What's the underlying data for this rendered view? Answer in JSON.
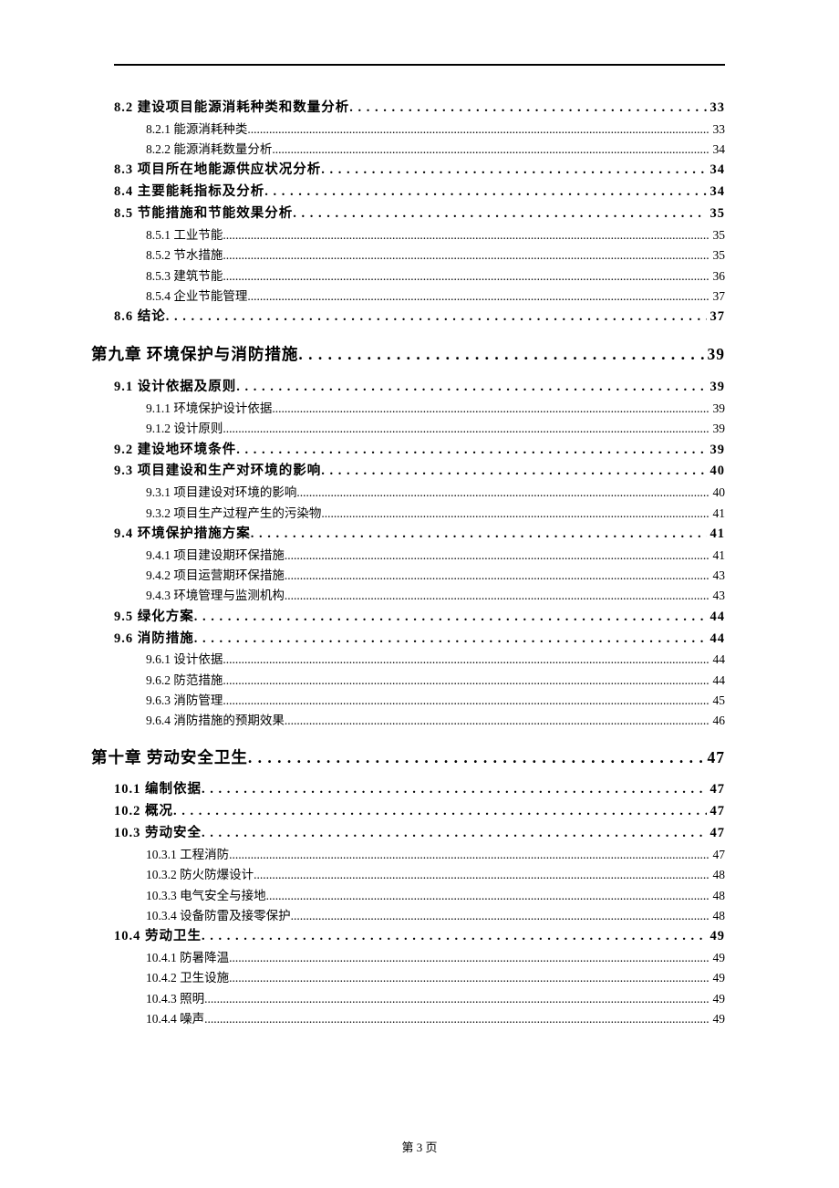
{
  "footer": "第 3 页",
  "toc": [
    {
      "level": 2,
      "title": "8.2 建设项目能源消耗种类和数量分析",
      "page": "33"
    },
    {
      "level": 3,
      "title": "8.2.1 能源消耗种类",
      "page": "33"
    },
    {
      "level": 3,
      "title": "8.2.2 能源消耗数量分析",
      "page": "34"
    },
    {
      "level": 2,
      "title": "8.3 项目所在地能源供应状况分析",
      "page": "34"
    },
    {
      "level": 2,
      "title": "8.4 主要能耗指标及分析",
      "page": "34"
    },
    {
      "level": 2,
      "title": "8.5 节能措施和节能效果分析",
      "page": "35"
    },
    {
      "level": 3,
      "title": "8.5.1 工业节能",
      "page": "35"
    },
    {
      "level": 3,
      "title": "8.5.2 节水措施",
      "page": "35"
    },
    {
      "level": 3,
      "title": "8.5.3 建筑节能",
      "page": "36"
    },
    {
      "level": 3,
      "title": "8.5.4 企业节能管理",
      "page": "37"
    },
    {
      "level": 2,
      "title": "8.6 结论",
      "page": "37"
    },
    {
      "level": 1,
      "title": "第九章 环境保护与消防措施",
      "page": "39"
    },
    {
      "level": 2,
      "title": "9.1 设计依据及原则",
      "page": "39"
    },
    {
      "level": 3,
      "title": "9.1.1 环境保护设计依据",
      "page": "39"
    },
    {
      "level": 3,
      "title": "9.1.2 设计原则",
      "page": "39"
    },
    {
      "level": 2,
      "title": "9.2 建设地环境条件",
      "page": "39"
    },
    {
      "level": 2,
      "title": "9.3 项目建设和生产对环境的影响",
      "page": "40"
    },
    {
      "level": 3,
      "title": "9.3.1 项目建设对环境的影响",
      "page": "40"
    },
    {
      "level": 3,
      "title": "9.3.2 项目生产过程产生的污染物",
      "page": "41"
    },
    {
      "level": 2,
      "title": "9.4 环境保护措施方案",
      "page": "41"
    },
    {
      "level": 3,
      "title": "9.4.1 项目建设期环保措施",
      "page": "41"
    },
    {
      "level": 3,
      "title": "9.4.2 项目运营期环保措施",
      "page": "43"
    },
    {
      "level": 3,
      "title": "9.4.3 环境管理与监测机构",
      "page": "43"
    },
    {
      "level": 2,
      "title": "9.5 绿化方案",
      "page": "44"
    },
    {
      "level": 2,
      "title": "9.6 消防措施",
      "page": "44"
    },
    {
      "level": 3,
      "title": "9.6.1 设计依据",
      "page": "44"
    },
    {
      "level": 3,
      "title": "9.6.2 防范措施",
      "page": "44"
    },
    {
      "level": 3,
      "title": "9.6.3 消防管理",
      "page": "45"
    },
    {
      "level": 3,
      "title": "9.6.4 消防措施的预期效果",
      "page": "46"
    },
    {
      "level": 1,
      "title": "第十章 劳动安全卫生",
      "page": "47"
    },
    {
      "level": 2,
      "title": "10.1 编制依据",
      "page": "47"
    },
    {
      "level": 2,
      "title": "10.2 概况",
      "page": "47"
    },
    {
      "level": 2,
      "title": "10.3 劳动安全",
      "page": "47"
    },
    {
      "level": 3,
      "title": "10.3.1 工程消防",
      "page": "47"
    },
    {
      "level": 3,
      "title": "10.3.2 防火防爆设计",
      "page": "48"
    },
    {
      "level": 3,
      "title": "10.3.3 电气安全与接地",
      "page": "48"
    },
    {
      "level": 3,
      "title": "10.3.4 设备防雷及接零保护",
      "page": "48"
    },
    {
      "level": 2,
      "title": "10.4 劳动卫生",
      "page": "49"
    },
    {
      "level": 3,
      "title": "10.4.1 防暑降温",
      "page": "49"
    },
    {
      "level": 3,
      "title": "10.4.2 卫生设施",
      "page": "49"
    },
    {
      "level": 3,
      "title": "10.4.3 照明",
      "page": "49"
    },
    {
      "level": 3,
      "title": "10.4.4 噪声",
      "page": "49"
    }
  ]
}
